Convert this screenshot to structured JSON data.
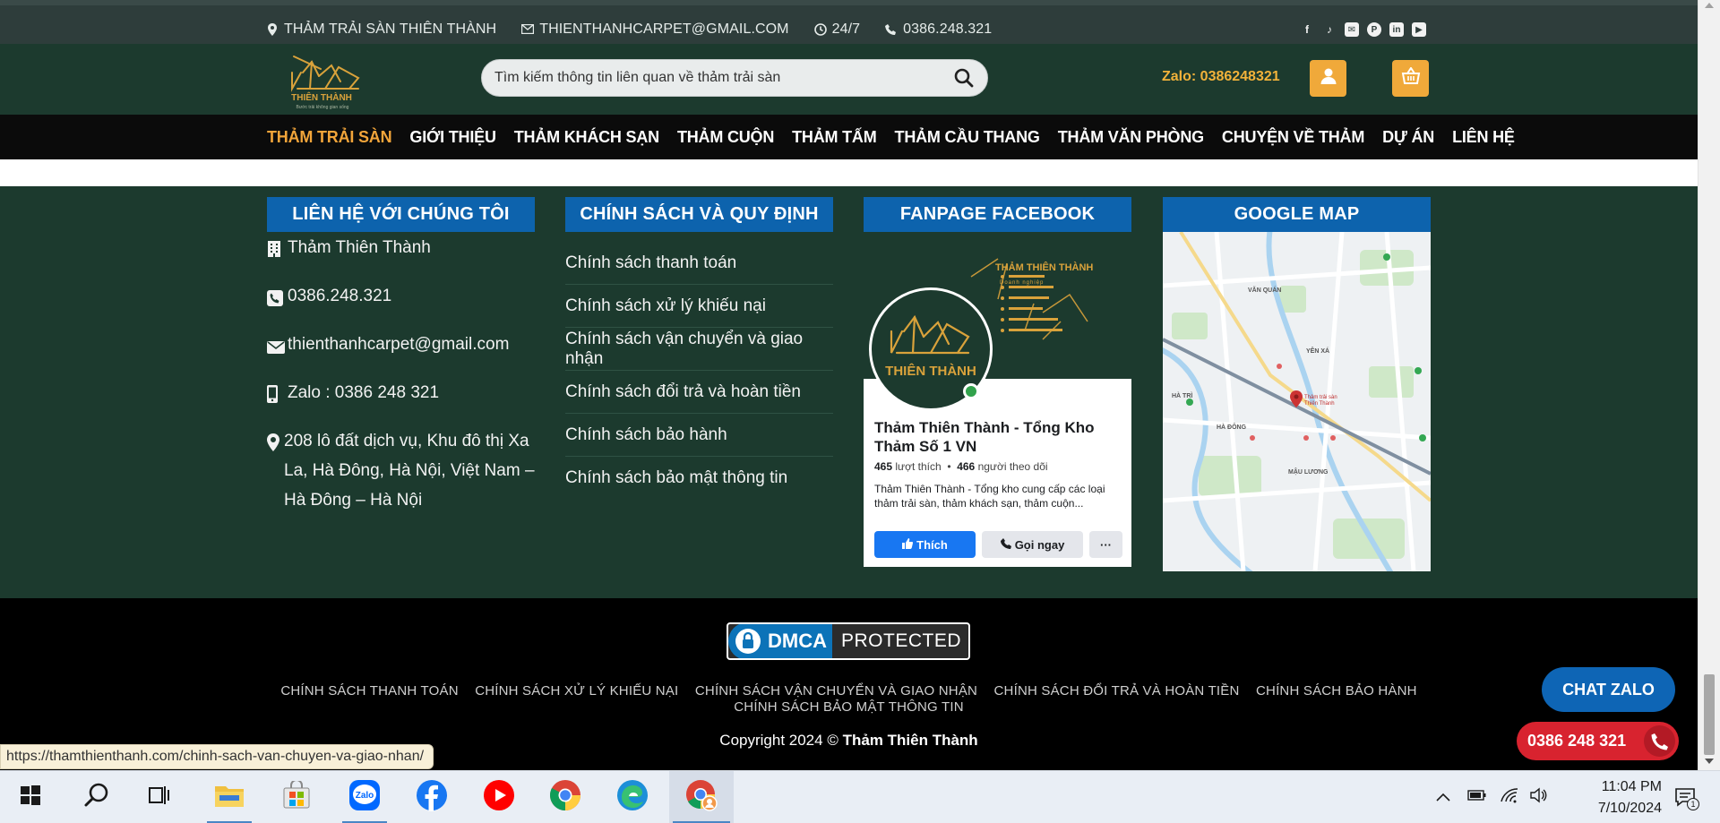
{
  "topbar": {
    "address": "THẢM TRẢI SÀN THIÊN THÀNH",
    "email": "THIENTHANHCARPET@GMAIL.COM",
    "hours": "24/7",
    "phone": "0386.248.321",
    "social_icons": [
      "facebook-icon",
      "tiktok-icon",
      "mail-icon",
      "pinterest-icon",
      "linkedin-icon",
      "youtube-icon"
    ]
  },
  "header": {
    "logo_text": "THIÊN THÀNH",
    "logo_tagline": "Bước trải không gian sống",
    "search_placeholder": "Tìm kiếm thông tin liên quan về thảm trải sàn",
    "zalo": "Zalo: 0386248321"
  },
  "nav": {
    "items": [
      {
        "label": "THẢM TRẢI SÀN",
        "active": true
      },
      {
        "label": "GIỚI THIỆU",
        "active": false
      },
      {
        "label": "THẢM KHÁCH SẠN",
        "active": false
      },
      {
        "label": "THẢM CUỘN",
        "active": false
      },
      {
        "label": "THẢM TẤM",
        "active": false
      },
      {
        "label": "THẢM CẦU THANG",
        "active": false
      },
      {
        "label": "THẢM VĂN PHÒNG",
        "active": false
      },
      {
        "label": "CHUYỆN VỀ THẢM",
        "active": false
      },
      {
        "label": "DỰ ÁN",
        "active": false
      },
      {
        "label": "LIÊN HỆ",
        "active": false
      }
    ]
  },
  "footer": {
    "contact": {
      "heading": "LIÊN HỆ VỚI CHÚNG TÔI",
      "company": "Thảm Thiên Thành",
      "phone": "0386.248.321",
      "email": "thienthanhcarpet@gmail.com",
      "zalo": "Zalo : 0386 248 321",
      "address": "208 lô đất dịch vụ, Khu đô thị Xa La, Hà Đông, Hà Nội, Việt Nam – Hà Đông – Hà Nội"
    },
    "policy": {
      "heading": "CHÍNH SÁCH VÀ QUY ĐỊNH",
      "items": [
        "Chính sách thanh toán",
        "Chính sách xử lý khiếu nại",
        "Chính sách vận chuyển và giao nhận",
        "Chính sách đổi trả và hoàn tiền",
        "Chính sách bảo hành",
        "Chính sách bảo mật thông tin"
      ]
    },
    "fanpage": {
      "heading": "FANPAGE FACEBOOK",
      "cover_title": "THẢM THIÊN THÀNH",
      "cover_subtitle": "Doanh nghiệp",
      "avatar_text": "THIÊN THÀNH",
      "page_name": "Thảm Thiên Thành - Tổng Kho Thảm Số 1 VN",
      "likes_count": "465",
      "likes_label": "lượt thích",
      "followers_count": "466",
      "followers_label": "người theo dõi",
      "description": "Thảm Thiên Thành - Tổng kho cung cấp các loại thảm trải sàn, thảm khách sạn, thảm cuộn...",
      "like_button": "Thích",
      "call_button": "Gọi ngay",
      "more_button": "···"
    },
    "map": {
      "heading": "GOOGLE MAP",
      "labels": [
        "YÊN XÁ",
        "HÀ TRÌ",
        "MẬU LƯƠNG",
        "VĂN QUÁN",
        "HÀ ĐÔNG",
        "Thảm trải sàn Thiên Thành"
      ]
    }
  },
  "bottom": {
    "dmca_word": "DMCA",
    "dmca_protected": "PROTECTED",
    "links": [
      "CHÍNH SÁCH THANH TOÁN",
      "CHÍNH SÁCH XỬ LÝ KHIẾU NẠI",
      "CHÍNH SÁCH VẬN CHUYỂN VÀ GIAO NHẬN",
      "CHÍNH SÁCH ĐỔI TRẢ VÀ HOÀN TIỀN",
      "CHÍNH SÁCH BẢO HÀNH",
      "CHÍNH SÁCH BẢO MẬT THÔNG TIN"
    ],
    "copyright_prefix": "Copyright 2024 ©",
    "copyright_name": "Thảm Thiên Thành"
  },
  "floating": {
    "chat_zalo": "CHAT ZALO",
    "call": "0386 248 321"
  },
  "status_url": "https://thamthienthanh.com/chinh-sach-van-chuyen-va-giao-nhan/",
  "taskbar": {
    "apps": [
      "start-icon",
      "search-icon",
      "task-view-icon",
      "file-explorer-icon",
      "store-icon",
      "zalo-icon",
      "facebook-icon",
      "youtube-icon",
      "chrome-icon",
      "edge-icon",
      "chrome-profile-icon"
    ],
    "time": "11:04 PM",
    "date": "7/10/2024",
    "notification_count": "1"
  },
  "colors": {
    "dark_green": "#1c3a2e",
    "accent_orange": "#f2a53a",
    "heading_blue": "#0d63ad",
    "call_red": "#d8232f"
  }
}
